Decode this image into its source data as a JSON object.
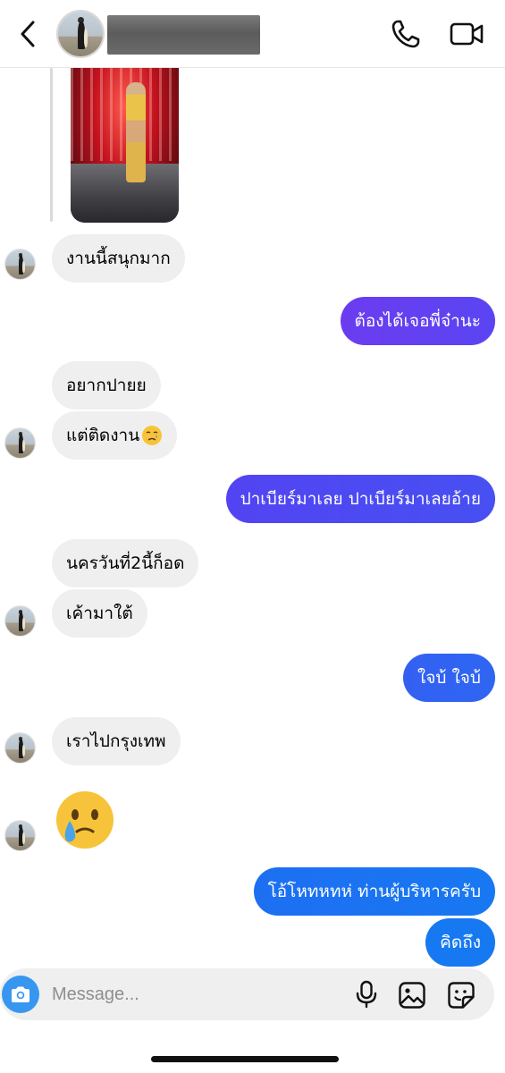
{
  "header": {
    "contact_name": "",
    "icons": {
      "back": "chevron-left-icon",
      "call": "phone-icon",
      "video": "video-camera-icon"
    }
  },
  "messages": [
    {
      "id": "m1",
      "side": "in",
      "text": "งานนี้สนุกมาก"
    },
    {
      "id": "m2",
      "side": "out",
      "text": "ต้องได้เจอพี่จ๋านะ"
    },
    {
      "id": "m3",
      "side": "in",
      "text": "อยากปายย"
    },
    {
      "id": "m4",
      "side": "in",
      "text": "แต่ติดงาน",
      "emoji": "crying-face"
    },
    {
      "id": "m5",
      "side": "out",
      "text": "ปาเบียร์มาเลย ปาเบียร์มาเลยอ้าย"
    },
    {
      "id": "m6",
      "side": "in",
      "text": "นครวันที่2นี้ก็อด"
    },
    {
      "id": "m7",
      "side": "in",
      "text": "เค้ามาใต้"
    },
    {
      "id": "m8",
      "side": "out",
      "text": "ใจบ้ ใจบ้"
    },
    {
      "id": "m9",
      "side": "in",
      "text": "เราไปกรุงเทพ"
    },
    {
      "id": "m10",
      "side": "in",
      "emoji": "face-holding-back-tears"
    },
    {
      "id": "m11",
      "side": "out",
      "text": "โอ้โหทหทห่ ท่านผู้บริหารครับ"
    },
    {
      "id": "m12",
      "side": "out",
      "text": "คิดถึง"
    }
  ],
  "composer": {
    "placeholder": "Message...",
    "value": "",
    "icons": {
      "camera": "camera-icon",
      "mic": "microphone-icon",
      "gallery": "image-icon",
      "sticker": "sticker-icon"
    }
  },
  "colors": {
    "incoming_bubble": "#efefef",
    "outgoing_gradient": [
      "#6a3df0",
      "#3d5cf2",
      "#1678f2"
    ],
    "camera_button": "#3797f0"
  }
}
